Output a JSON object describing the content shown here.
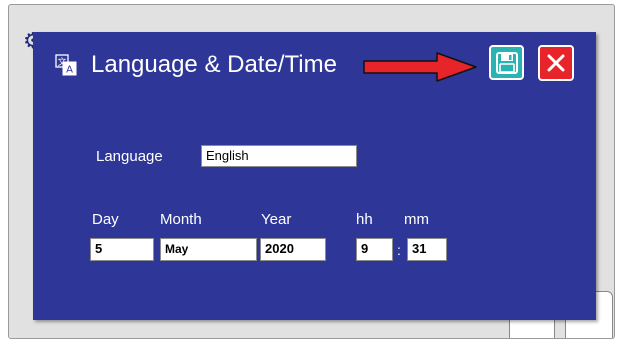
{
  "dialog": {
    "title": "Language & Date/Time",
    "title_icon": "language-translate-icon",
    "save_icon": "floppy-disk-save-icon",
    "close_icon": "close-x-icon",
    "arrow": "red-arrow-pointing-right"
  },
  "language": {
    "label": "Language",
    "value": "English"
  },
  "datetime": {
    "day_label": "Day",
    "month_label": "Month",
    "year_label": "Year",
    "hour_label": "hh",
    "minute_label": "mm",
    "day_value": "5",
    "month_value": "May",
    "year_value": "2020",
    "hour_value": "9",
    "separator": ":",
    "minute_value": "31"
  },
  "colors": {
    "dialog_bg": "#2e3798",
    "save_button": "#2bb3b3",
    "close_button": "#e8242b",
    "arrow": "#e8242b"
  }
}
